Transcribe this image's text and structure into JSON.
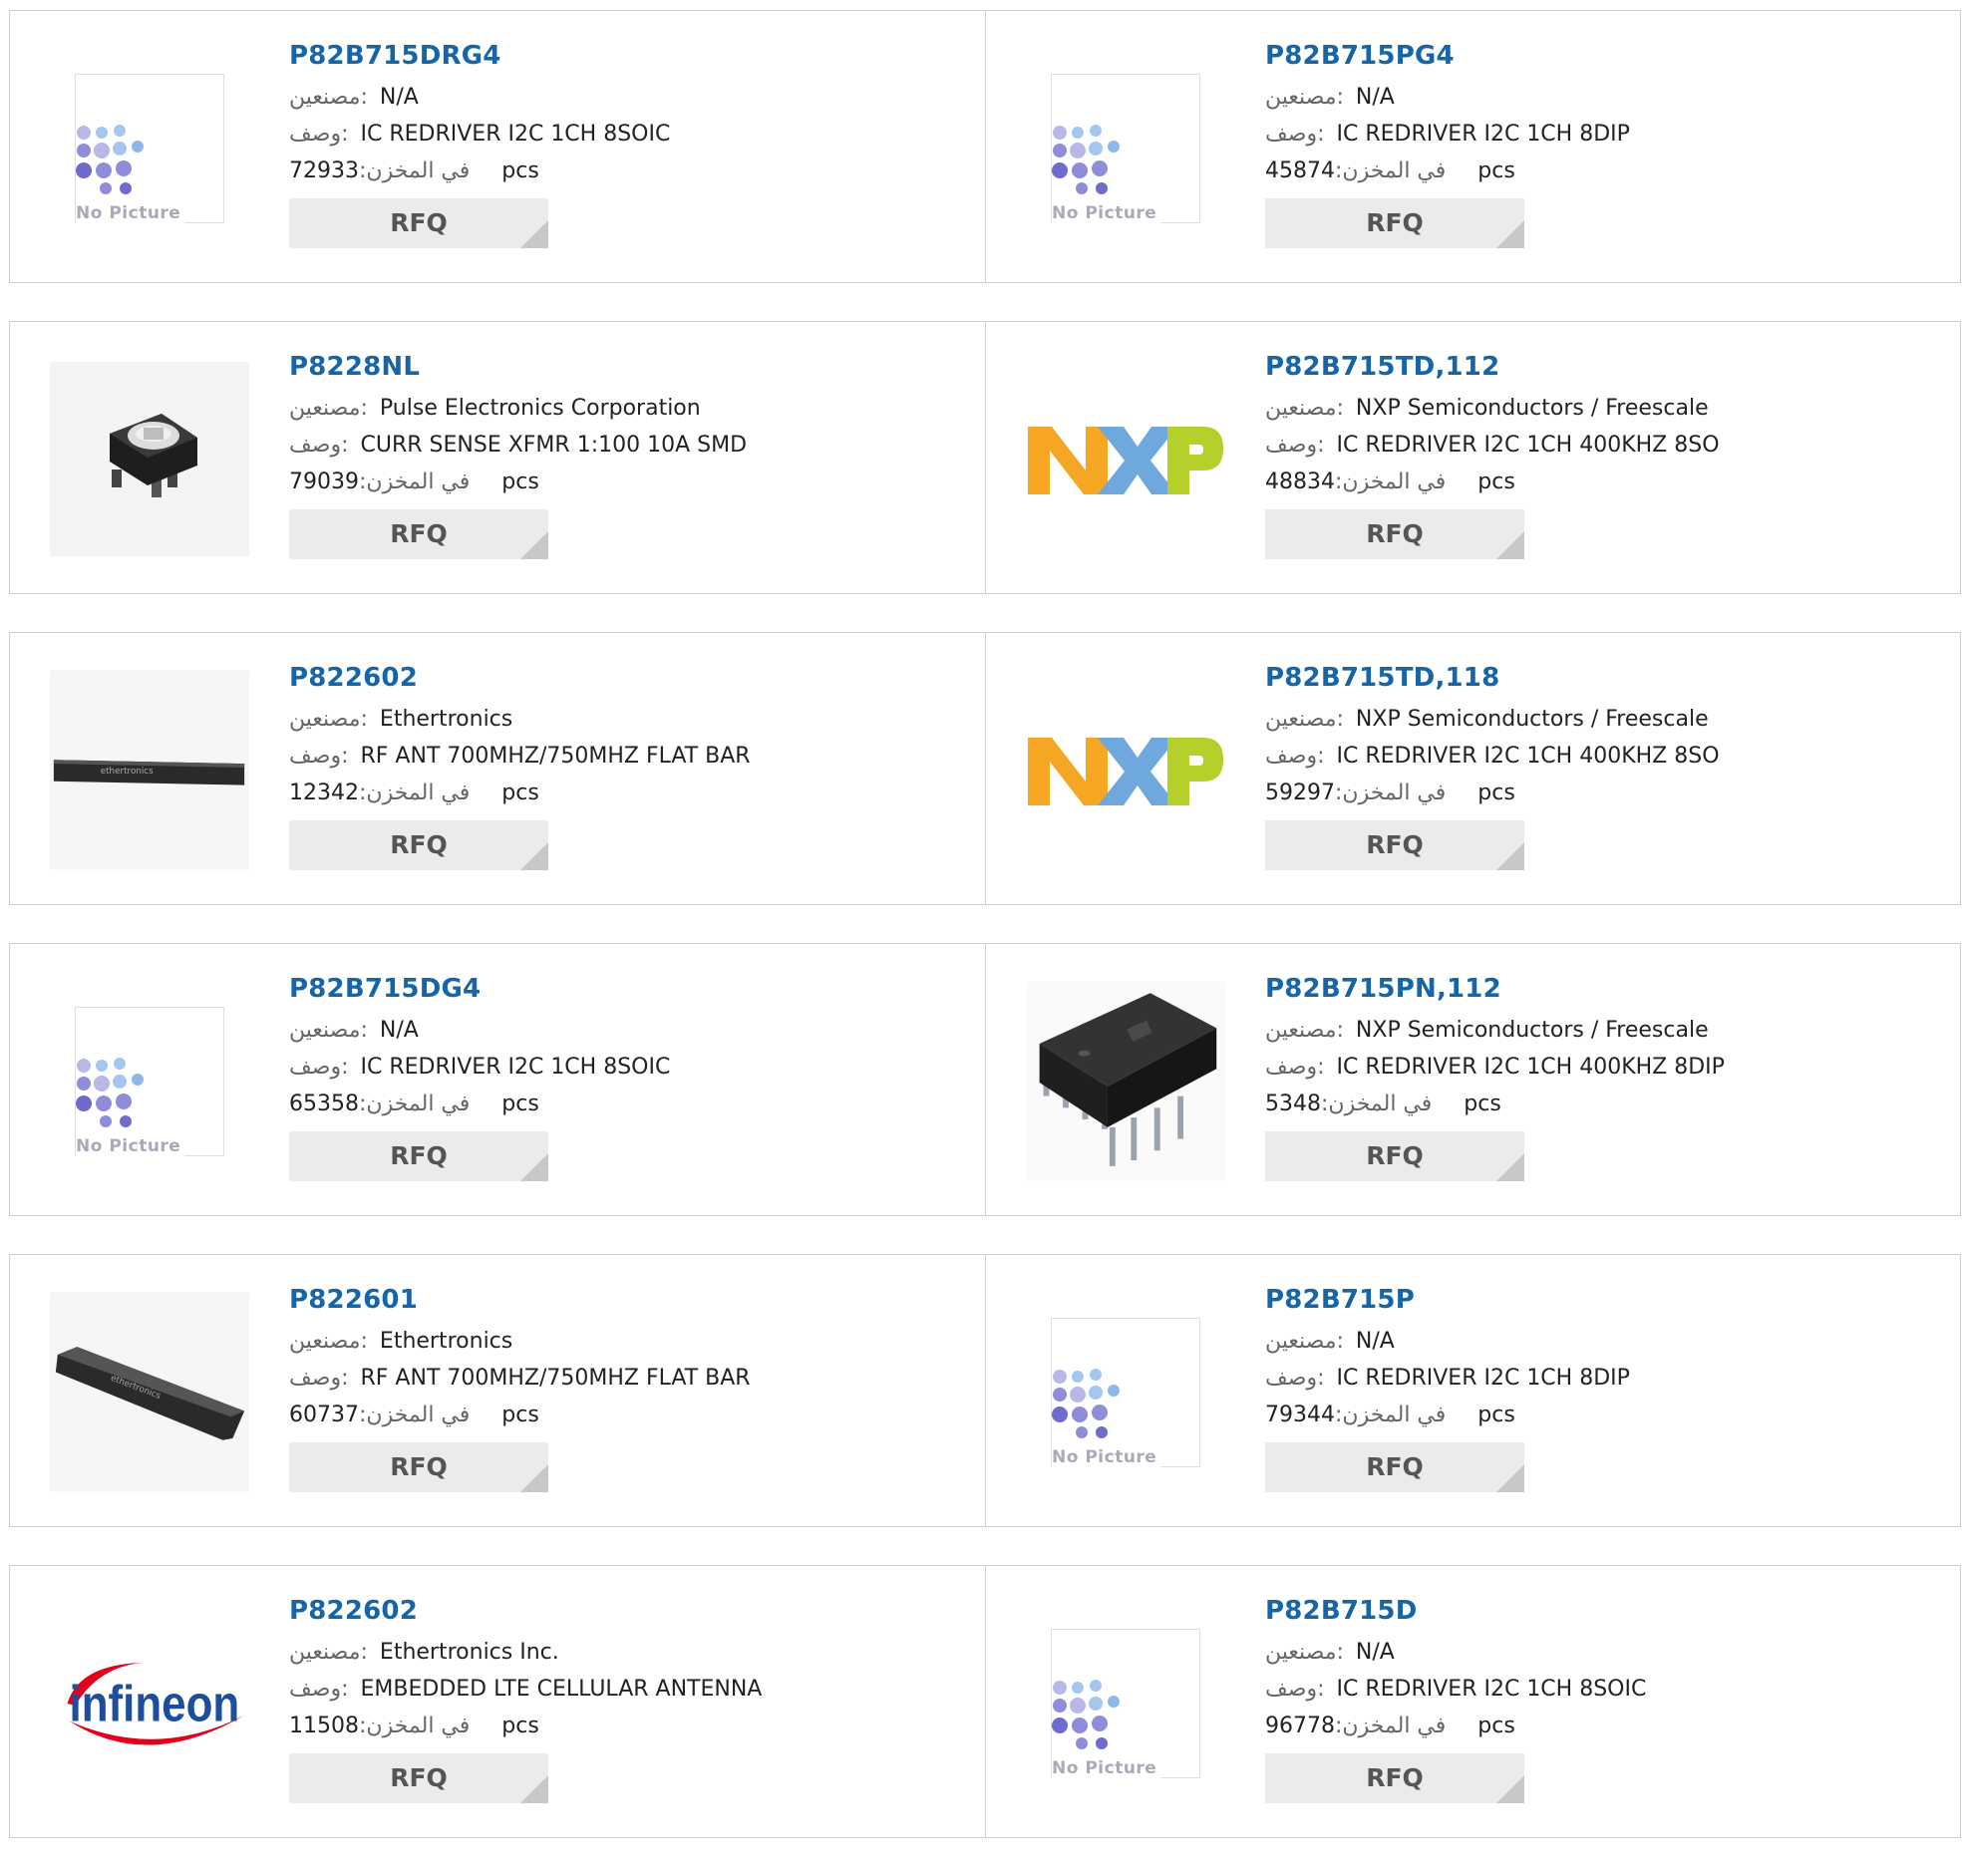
{
  "labels": {
    "manufacturer": "مصنعين:",
    "description": "وصف:",
    "stock": "في المخزن:",
    "unit": "pcs",
    "rfq": "RFQ",
    "no_picture": "No Picture"
  },
  "products": [
    {
      "part": "P82B715DRG4",
      "manufacturer": "N/A",
      "description": "IC REDRIVER I2C 1CH 8SOIC",
      "stock": "72933",
      "image": "no-picture"
    },
    {
      "part": "P82B715PG4",
      "manufacturer": "N/A",
      "description": "IC REDRIVER I2C 1CH 8DIP",
      "stock": "45874",
      "image": "no-picture"
    },
    {
      "part": "P8228NL",
      "manufacturer": "Pulse Electronics Corporation",
      "description": "CURR SENSE XFMR 1:100 10A SMD",
      "stock": "79039",
      "image": "transformer-photo"
    },
    {
      "part": "P82B715TD,112",
      "manufacturer": "NXP Semiconductors / Freescale",
      "description": "IC REDRIVER I2C 1CH 400KHZ 8SO",
      "stock": "48834",
      "image": "nxp-logo"
    },
    {
      "part": "P822602",
      "manufacturer": "Ethertronics",
      "description": "RF ANT 700MHZ/750MHZ FLAT BAR",
      "stock": "12342",
      "image": "antenna-photo-flat"
    },
    {
      "part": "P82B715TD,118",
      "manufacturer": "NXP Semiconductors / Freescale",
      "description": "IC REDRIVER I2C 1CH 400KHZ 8SO",
      "stock": "59297",
      "image": "nxp-logo"
    },
    {
      "part": "P82B715DG4",
      "manufacturer": "N/A",
      "description": "IC REDRIVER I2C 1CH 8SOIC",
      "stock": "65358",
      "image": "no-picture"
    },
    {
      "part": "P82B715PN,112",
      "manufacturer": "NXP Semiconductors / Freescale",
      "description": "IC REDRIVER I2C 1CH 400KHZ 8DIP",
      "stock": "5348",
      "image": "dip-chip-photo"
    },
    {
      "part": "P822601",
      "manufacturer": "Ethertronics",
      "description": "RF ANT 700MHZ/750MHZ FLAT BAR",
      "stock": "60737",
      "image": "antenna-photo-angled"
    },
    {
      "part": "P82B715P",
      "manufacturer": "N/A",
      "description": "IC REDRIVER I2C 1CH 8DIP",
      "stock": "79344",
      "image": "no-picture"
    },
    {
      "part": "P822602",
      "manufacturer": "Ethertronics Inc.",
      "description": "EMBEDDED LTE CELLULAR ANTENNA",
      "stock": "11508",
      "image": "infineon-logo"
    },
    {
      "part": "P82B715D",
      "manufacturer": "N/A",
      "description": "IC REDRIVER I2C 1CH 8SOIC",
      "stock": "96778",
      "image": "no-picture"
    }
  ],
  "images": {
    "nxp_logo_text": "NXP",
    "infineon_logo_text": "infineon",
    "antenna_brand": "ethertronics"
  },
  "colors": {
    "part_link": "#1565a8",
    "nxp_orange": "#f5a623",
    "nxp_blue": "#6fa8dc",
    "nxp_green": "#b5cf2b",
    "infineon_blue": "#1d4e9e",
    "infineon_red": "#e2001a"
  }
}
